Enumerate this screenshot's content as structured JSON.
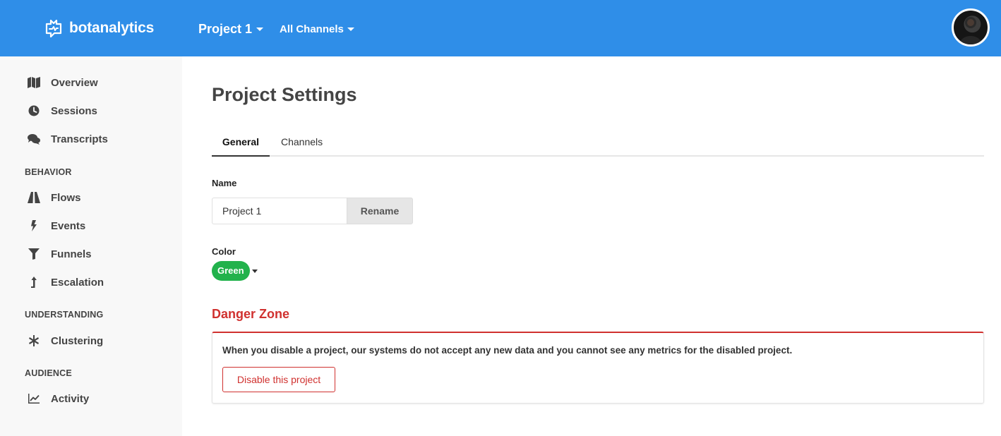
{
  "header": {
    "brand": "botanalytics",
    "project_label": "Project 1",
    "channel_label": "All Channels"
  },
  "sidebar": {
    "items_top": [
      {
        "label": "Overview",
        "icon": "map-icon"
      },
      {
        "label": "Sessions",
        "icon": "clock-icon"
      },
      {
        "label": "Transcripts",
        "icon": "chat-bubbles-icon"
      }
    ],
    "sections": [
      {
        "title": "BEHAVIOR",
        "items": [
          {
            "label": "Flows",
            "icon": "road-icon"
          },
          {
            "label": "Events",
            "icon": "bolt-icon"
          },
          {
            "label": "Funnels",
            "icon": "filter-icon"
          },
          {
            "label": "Escalation",
            "icon": "level-up-icon"
          }
        ]
      },
      {
        "title": "UNDERSTANDING",
        "items": [
          {
            "label": "Clustering",
            "icon": "asterisk-icon"
          }
        ]
      },
      {
        "title": "AUDIENCE",
        "items": [
          {
            "label": "Activity",
            "icon": "line-chart-icon"
          }
        ]
      }
    ]
  },
  "main": {
    "title": "Project Settings",
    "tabs": [
      {
        "label": "General",
        "active": true
      },
      {
        "label": "Channels",
        "active": false
      }
    ],
    "name_label": "Name",
    "name_value": "Project 1",
    "rename_label": "Rename",
    "color_label": "Color",
    "color_value": "Green",
    "danger": {
      "title": "Danger Zone",
      "text": "When you disable a project, our systems do not accept any new data and you cannot see any metrics for the disabled project.",
      "button_label": "Disable this project"
    }
  },
  "colors": {
    "topbar": "#2f8ee8",
    "sidebar": "#f8f8f8",
    "green": "#22b24c",
    "danger": "#d0312f"
  }
}
